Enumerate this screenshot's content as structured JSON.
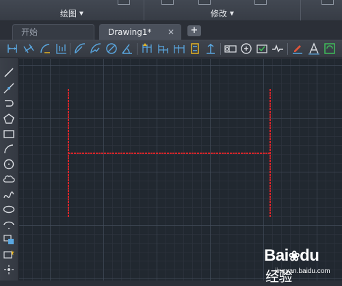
{
  "ribbon": {
    "panels": [
      {
        "label": "绘图"
      },
      {
        "label": "修改"
      }
    ]
  },
  "tabs": {
    "start_label": "开始",
    "drawing_label": "Drawing1*",
    "close_glyph": "✕",
    "new_tab_glyph": "+"
  },
  "toolbar": {
    "icons": [
      "linear-dimension-icon",
      "aligned-dimension-icon",
      "arc-length-dimension-icon",
      "ordinate-dimension-icon",
      "radius-dimension-icon",
      "jogged-dimension-icon",
      "diameter-dimension-icon",
      "angular-dimension-icon",
      "quick-dimension-icon",
      "baseline-dimension-icon",
      "continue-dimension-icon",
      "dimension-space-icon",
      "dimension-break-icon",
      "tolerance-icon",
      "center-mark-icon",
      "inspection-icon",
      "jogged-linear-icon",
      "dimension-edit-icon",
      "dimension-text-edit-icon",
      "dimension-update-icon"
    ]
  },
  "drawing": {
    "line_color": "#d8262a",
    "shape": "H-shape made of two vertical lines joined by a horizontal crossbar"
  },
  "watermark": {
    "brand": "Bai",
    "brand_suffix": "du",
    "cn_text": "经验",
    "url": "jingyan.baidu.com"
  },
  "colors": {
    "canvas_bg": "#212830",
    "panel_bg": "#3a3f48",
    "accent_yellow": "#e6b422",
    "accent_blue": "#5aa7e0"
  }
}
